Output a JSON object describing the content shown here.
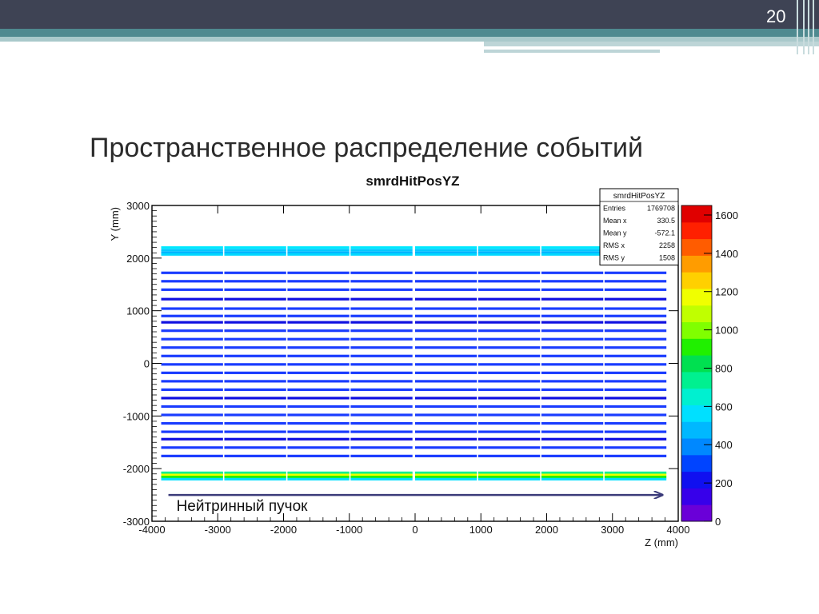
{
  "slide": {
    "number": "20",
    "title": "Пространственное распределение  событий"
  },
  "chart_data": {
    "type": "heatmap",
    "title": "smrdHitPosYZ",
    "xlabel": "Z (mm)",
    "ylabel": "Y (mm)",
    "xlim": [
      -4000,
      4000
    ],
    "ylim": [
      -3000,
      3000
    ],
    "x_ticks": [
      -4000,
      -3000,
      -2000,
      -1000,
      0,
      1000,
      2000,
      3000,
      4000
    ],
    "y_ticks": [
      -3000,
      -2000,
      -1000,
      0,
      1000,
      2000,
      3000
    ],
    "colorbar": {
      "min": 0,
      "max": 1650,
      "ticks": [
        0,
        200,
        400,
        600,
        800,
        1000,
        1200,
        1400,
        1600
      ],
      "colors": [
        "#6a00d8",
        "#3700ea",
        "#1010f0",
        "#0044ff",
        "#0088ff",
        "#00b8ff",
        "#00e0ff",
        "#00f0d0",
        "#00f090",
        "#00e050",
        "#20f000",
        "#80ff00",
        "#c0ff00",
        "#f0ff00",
        "#ffd000",
        "#ff9c00",
        "#ff5c00",
        "#ff2000",
        "#e00000"
      ]
    },
    "stats_box": {
      "title": "smrdHitPosYZ",
      "rows": [
        {
          "label": "Entries",
          "value": "1769708"
        },
        {
          "label": "Mean x",
          "value": "330.5"
        },
        {
          "label": "Mean y",
          "value": "-572.1"
        },
        {
          "label": "RMS x",
          "value": "2258"
        },
        {
          "label": "RMS y",
          "value": "1508"
        }
      ]
    },
    "z_segments": [
      [
        -3860,
        -2920
      ],
      [
        -2900,
        -1960
      ],
      [
        -1940,
        -1000
      ],
      [
        -980,
        -40
      ],
      [
        0,
        940
      ],
      [
        960,
        1900
      ],
      [
        1920,
        2860
      ],
      [
        2880,
        3820
      ]
    ],
    "layers": [
      {
        "y": 2200,
        "c": "#00e8ff"
      },
      {
        "y": 2150,
        "c": "#00c8ff"
      },
      {
        "y": 2100,
        "c": "#00b0ff"
      },
      {
        "y": 2070,
        "c": "#00d8ff"
      },
      {
        "y": 1720,
        "c": "#1a3cff"
      },
      {
        "y": 1560,
        "c": "#1a3cff"
      },
      {
        "y": 1400,
        "c": "#1a3cff"
      },
      {
        "y": 1220,
        "c": "#1010e0"
      },
      {
        "y": 1040,
        "c": "#1a3cff"
      },
      {
        "y": 900,
        "c": "#1a3cff"
      },
      {
        "y": 780,
        "c": "#1010e0"
      },
      {
        "y": 620,
        "c": "#1a3cff"
      },
      {
        "y": 460,
        "c": "#1a3cff"
      },
      {
        "y": 300,
        "c": "#1a3cff"
      },
      {
        "y": 140,
        "c": "#1a3cff"
      },
      {
        "y": -20,
        "c": "#1a3cff"
      },
      {
        "y": -180,
        "c": "#1a3cff"
      },
      {
        "y": -340,
        "c": "#1a3cff"
      },
      {
        "y": -500,
        "c": "#1a3cff"
      },
      {
        "y": -660,
        "c": "#1010e0"
      },
      {
        "y": -820,
        "c": "#1a3cff"
      },
      {
        "y": -980,
        "c": "#1a3cff"
      },
      {
        "y": -1140,
        "c": "#1a3cff"
      },
      {
        "y": -1300,
        "c": "#1a3cff"
      },
      {
        "y": -1440,
        "c": "#1010e0"
      },
      {
        "y": -1600,
        "c": "#1a3cff"
      },
      {
        "y": -1760,
        "c": "#1a3cff"
      },
      {
        "y": -2080,
        "c": "#00f090"
      },
      {
        "y": -2120,
        "c": "#f0ff00"
      },
      {
        "y": -2160,
        "c": "#20f000"
      },
      {
        "y": -2200,
        "c": "#00e0ff"
      }
    ],
    "annotation": {
      "text": "Нейтринный пучок",
      "arrow_from": [
        -3750,
        -2500
      ],
      "arrow_to": [
        3750,
        -2500
      ]
    }
  }
}
